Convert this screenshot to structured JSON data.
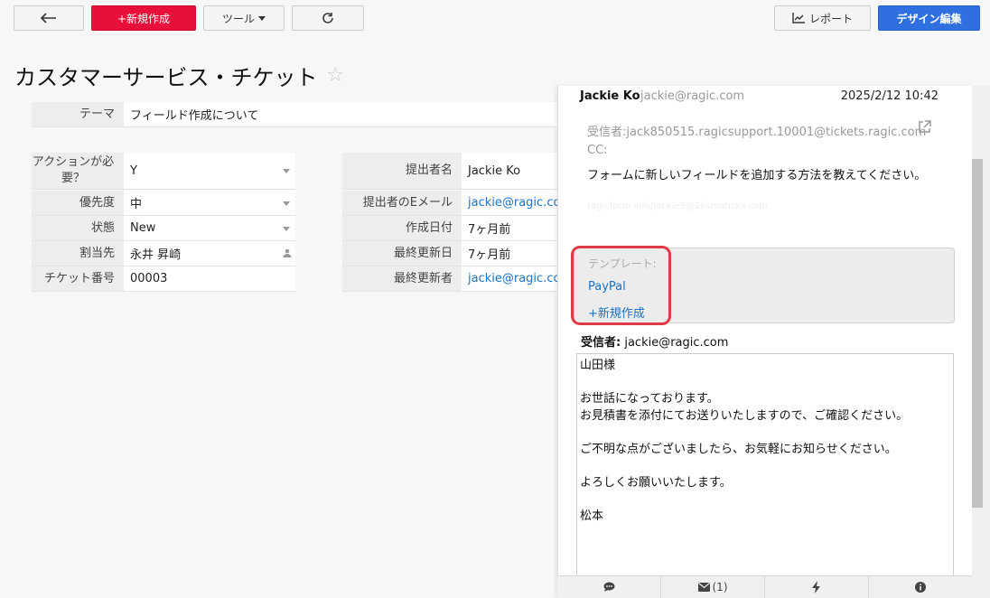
{
  "toolbar": {
    "new_label": "+新規作成",
    "tools_label": "ツール",
    "report_label": "レポート",
    "design_label": "デザイン編集"
  },
  "page": {
    "title": "カスタマーサービス・チケット"
  },
  "form": {
    "theme": {
      "label": "テーマ",
      "value": "フィールド作成について"
    },
    "left": [
      {
        "label": "アクションが必要？",
        "value": "Y"
      },
      {
        "label": "優先度",
        "value": "中"
      },
      {
        "label": "状態",
        "value": "New"
      },
      {
        "label": "割当先",
        "value": "永井 昇崎"
      },
      {
        "label": "チケット番号",
        "value": "00003"
      }
    ],
    "right": [
      {
        "label": "提出者名",
        "value": "Jackie Ko"
      },
      {
        "label": "提出者のEメール",
        "value": "jackie@ragic.com"
      },
      {
        "label": "作成日付",
        "value": "7ヶ月前"
      },
      {
        "label": "最終更新日",
        "value": "7ヶ月前"
      },
      {
        "label": "最終更新者",
        "value": "jackie@ragic.com"
      }
    ]
  },
  "email": {
    "sender_name": "Jackie Ko",
    "sender_email": "jackie@ragic.com",
    "datetime": "2025/2/12 10:42",
    "recipient": "受信者:jack850515.ragicsupport.10001@tickets.ragic.com",
    "cc": "CC:",
    "body": "フォームに新しいフィールドを追加する方法を教えてください。",
    "faint_text": "ragicform.info/jackie5@2ksmaticks.com",
    "template_label": "テンプレート:",
    "templates": [
      "PayPal",
      "+新規作成"
    ],
    "to_label": "受信者:",
    "to_value": "jackie@ragic.com",
    "compose_lines": [
      "山田様",
      "",
      "お世話になっております。",
      "お見積書を添付にてお送りいたしますので、ご確認ください。",
      "",
      "ご不明な点がございましたら、お気軽にお知らせください。",
      "",
      "よろしくお願いいたします。",
      "",
      "松本"
    ]
  },
  "bottombar": {
    "mail_count": "(1)"
  },
  "colors": {
    "accent_red": "#e8103a",
    "accent_blue": "#2f6fe0",
    "link": "#1a73c8",
    "highlight": "#e0394a"
  }
}
